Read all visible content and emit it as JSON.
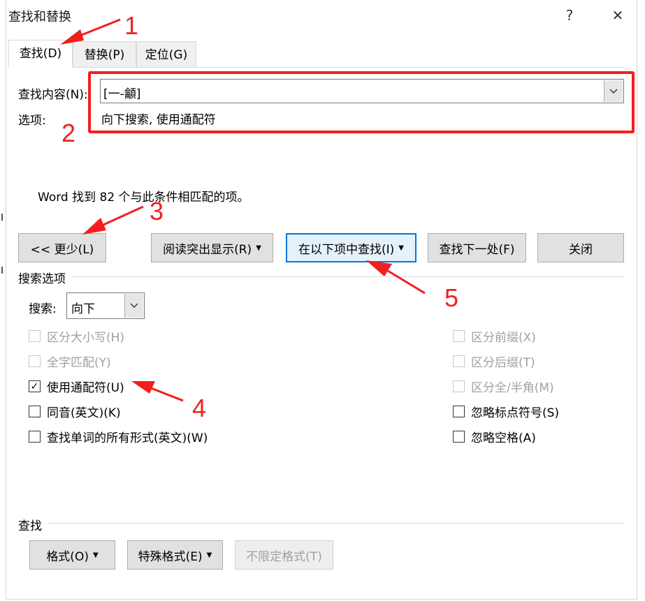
{
  "window": {
    "title": "查找和替换",
    "help_glyph": "?",
    "close_glyph": "✕"
  },
  "tabs": [
    {
      "label": "查找(D)",
      "active": true
    },
    {
      "label": "替换(P)",
      "active": false
    },
    {
      "label": "定位(G)",
      "active": false
    }
  ],
  "find": {
    "label": "查找内容(N):",
    "value": "[一-龥]"
  },
  "options": {
    "label": "选项:",
    "value": "向下搜索, 使用通配符"
  },
  "status_message": "Word 找到 82 个与此条件相匹配的项。",
  "buttons": {
    "less": "<< 更少(L)",
    "reading_highlight": "阅读突出显示(R)",
    "find_in": "在以下项中查找(I)",
    "find_next": "查找下一处(F)",
    "close": "关闭"
  },
  "search_options": {
    "section_label": "搜索选项",
    "search_label": "搜索:",
    "search_direction": "向下",
    "left_checks": [
      {
        "label": "区分大小写(H)",
        "checked": false,
        "disabled": true
      },
      {
        "label": "全字匹配(Y)",
        "checked": false,
        "disabled": true
      },
      {
        "label": "使用通配符(U)",
        "checked": true,
        "disabled": false
      },
      {
        "label": "同音(英文)(K)",
        "checked": false,
        "disabled": false
      },
      {
        "label": "查找单词的所有形式(英文)(W)",
        "checked": false,
        "disabled": false
      }
    ],
    "right_checks": [
      {
        "label": "区分前缀(X)",
        "checked": false,
        "disabled": true
      },
      {
        "label": "区分后缀(T)",
        "checked": false,
        "disabled": true
      },
      {
        "label": "区分全/半角(M)",
        "checked": false,
        "disabled": true
      },
      {
        "label": "忽略标点符号(S)",
        "checked": false,
        "disabled": false
      },
      {
        "label": "忽略空格(A)",
        "checked": false,
        "disabled": false
      }
    ]
  },
  "find_section": {
    "label": "查找",
    "format": "格式(O)",
    "special": "特殊格式(E)",
    "no_format": "不限定格式(T)"
  },
  "annotations": {
    "n1": "1",
    "n2": "2",
    "n3": "3",
    "n4": "4",
    "n5": "5",
    "color": "#f21f1f"
  }
}
